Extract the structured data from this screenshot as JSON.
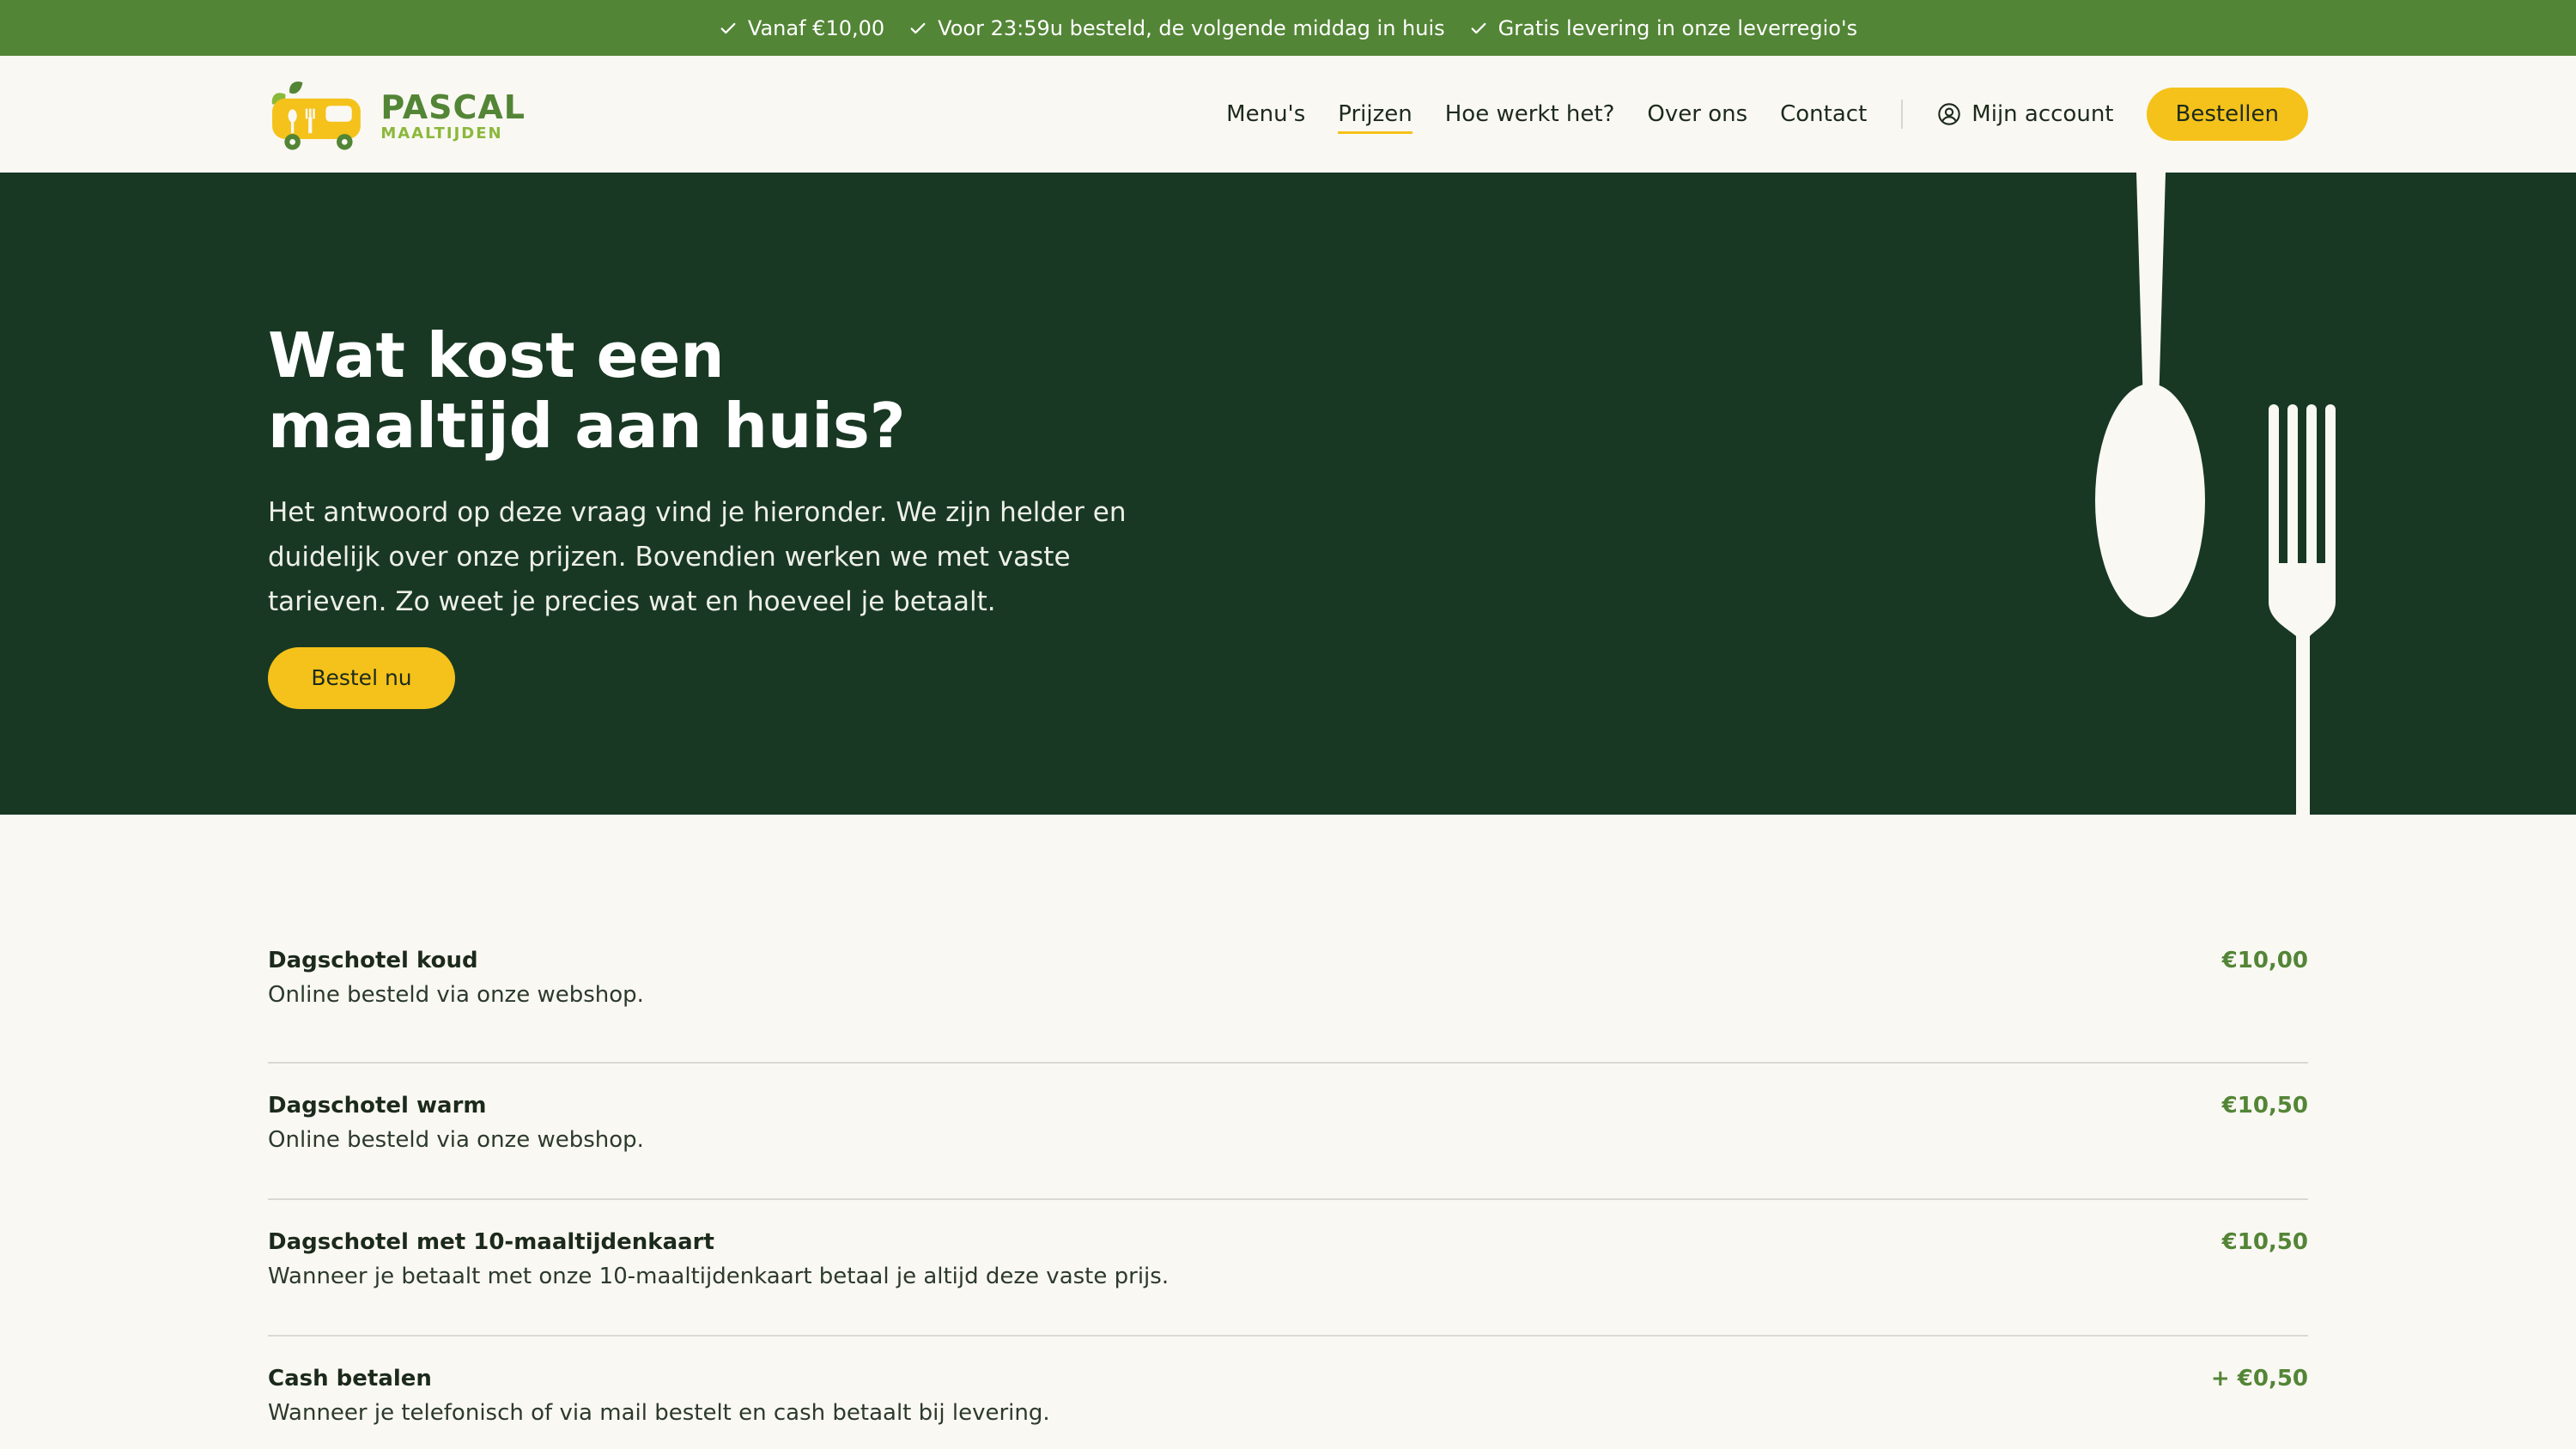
{
  "topbar": {
    "items": [
      "Vanaf €10,00",
      "Voor 23:59u besteld, de volgende middag in huis",
      "Gratis levering in onze leverregio's"
    ]
  },
  "logo": {
    "name": "PASCAL",
    "sub": "MAALTIJDEN"
  },
  "nav": {
    "items": [
      "Menu's",
      "Prijzen",
      "Hoe werkt het?",
      "Over ons",
      "Contact"
    ],
    "active": "Prijzen",
    "account": "Mijn account",
    "order": "Bestellen"
  },
  "hero": {
    "title_line1": "Wat kost een",
    "title_line2": "maaltijd aan huis?",
    "text": "Het antwoord op deze vraag vind je hieronder. We zijn helder en duidelijk over onze prijzen. Bovendien werken we met vaste tarieven. Zo weet je precies wat en hoeveel je betaalt.",
    "button": "Bestel nu"
  },
  "prices": [
    {
      "name": "Dagschotel koud",
      "desc": "Online besteld via onze webshop.",
      "amount": "€10,00"
    },
    {
      "name": "Dagschotel warm",
      "desc": "Online besteld via onze webshop.",
      "amount": "€10,50"
    },
    {
      "name": "Dagschotel met 10-maaltijdenkaart",
      "desc": "Wanneer je betaalt met onze 10-maaltijdenkaart betaal je altijd deze vaste prijs.",
      "amount": "€10,50"
    },
    {
      "name": "Cash betalen",
      "desc": "Wanneer je telefonisch of via mail bestelt en cash betaalt bij levering.",
      "amount": "+ €0,50"
    }
  ],
  "colors": {
    "topbar": "#538536",
    "hero": "#183823",
    "accent": "#f4c21a",
    "price": "#538536",
    "background": "#faf8f3"
  }
}
